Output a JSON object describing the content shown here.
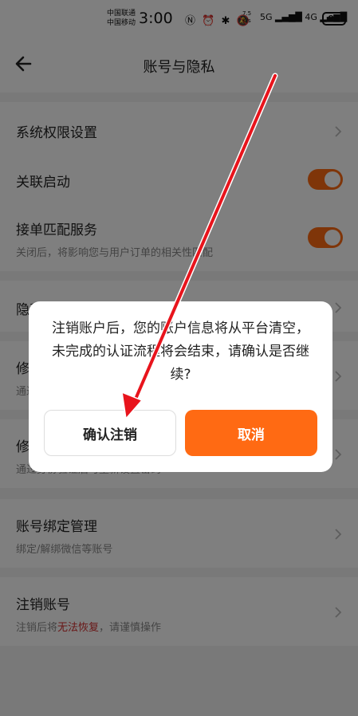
{
  "status_bar": {
    "carrier_1": "中国联通",
    "carrier_2": "中国移动",
    "time": "3:00",
    "speed_value": "7.5",
    "speed_unit": "K/s",
    "net_label": "5G ▂▄▆█ 4G ▂▄▆█",
    "battery": "98",
    "icons": [
      "nfc-icon",
      "alarm-icon",
      "bluetooth-icon",
      "mute-icon",
      "wifi-icon",
      "signal-icon"
    ]
  },
  "header": {
    "title": "账号与隐私"
  },
  "settings": {
    "system_permissions": {
      "title": "系统权限设置"
    },
    "linked_startup": {
      "title": "关联启动",
      "enabled": true
    },
    "order_matching": {
      "title": "接单匹配服务",
      "subtitle": "关闭后，将影响您与用户订单的相关性匹配",
      "enabled": true
    },
    "privacy_policy": {
      "title": "隐私政策"
    },
    "modify_1": {
      "title": "修改",
      "subtitle": "通过"
    },
    "modify_2": {
      "title": "修改",
      "subtitle": "通过身份验证后可重新设置密码"
    },
    "account_binding": {
      "title": "账号绑定管理",
      "subtitle": "绑定/解绑微信等账号"
    },
    "cancel_account": {
      "title": "注销账号",
      "subtitle_prefix": "注销后将",
      "subtitle_emphasis": "无法恢复",
      "subtitle_suffix": "，请谨慎操作"
    }
  },
  "dialog": {
    "message": "注销账户后，您的账户信息将从平台清空，未完成的认证流程将会结束，请确认是否继续?",
    "confirm_label": "确认注销",
    "cancel_label": "取消"
  },
  "colors": {
    "accent": "#ff6a13",
    "warning_text": "#d32f2f",
    "annotation_arrow": "#e8141c"
  }
}
